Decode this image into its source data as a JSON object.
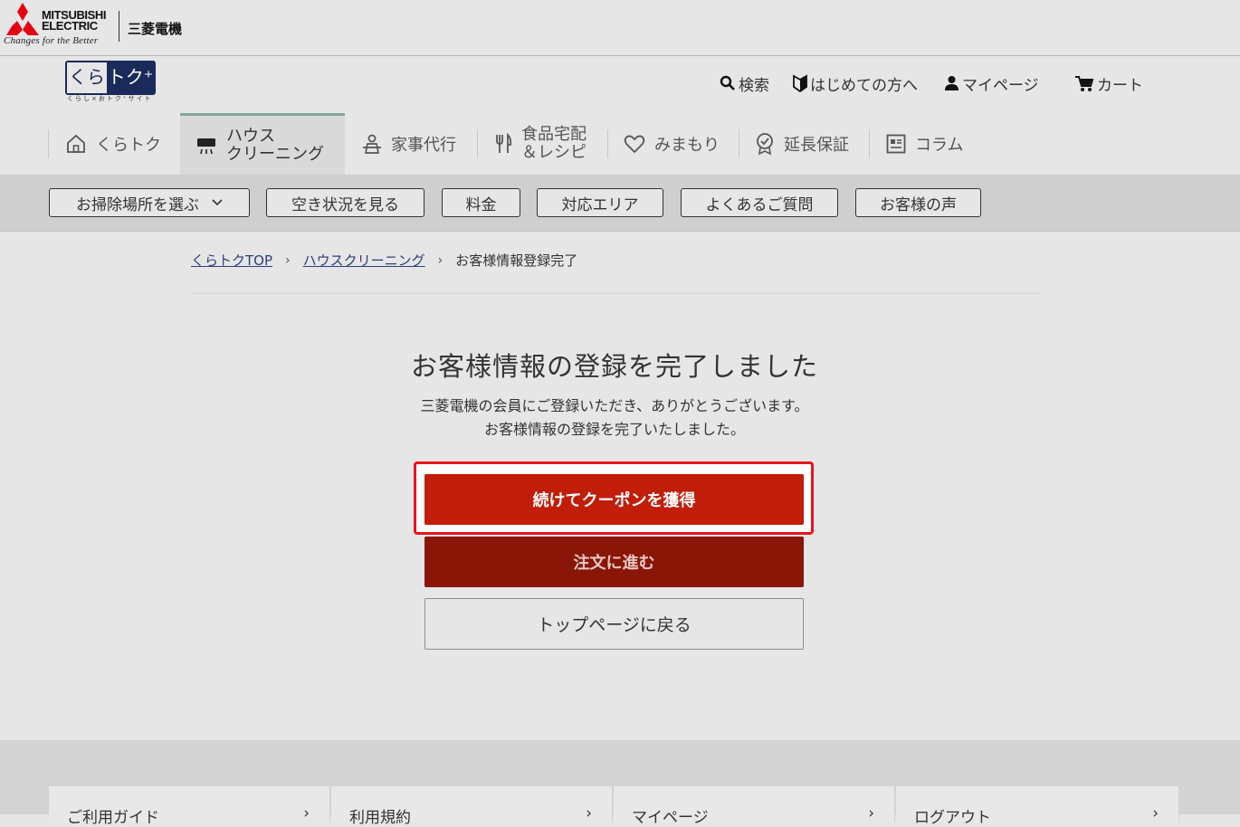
{
  "brand": {
    "company_en_line1": "MITSUBISHI",
    "company_en_line2": "ELECTRIC",
    "tagline": "Changes for the Better",
    "company_jp": "三菱電機",
    "red": "#e60012"
  },
  "site_logo": {
    "left": "くら",
    "right": "トク⁺",
    "sub": "くらし×おトク⁺サイト"
  },
  "utility_nav": {
    "search": "検索",
    "first_time": "はじめての方へ",
    "mypage": "マイページ",
    "cart": "カート"
  },
  "main_nav": {
    "home": "くらトク",
    "cleaning_line1": "ハウス",
    "cleaning_line2": "クリーニング",
    "housework": "家事代行",
    "food_line1": "食品宅配",
    "food_line2": "＆レシピ",
    "watch": "みまもり",
    "warranty": "延長保証",
    "column": "コラム",
    "active_accent": "#7fa79c"
  },
  "sub_nav": {
    "choose_place": "お掃除場所を選ぶ",
    "availability": "空き状況を見る",
    "price": "料金",
    "area": "対応エリア",
    "faq": "よくあるご質問",
    "voice": "お客様の声"
  },
  "breadcrumb": {
    "home": "くらトクTOP",
    "section": "ハウスクリーニング",
    "current": "お客様情報登録完了"
  },
  "content": {
    "title": "お客様情報の登録を完了しました",
    "message_line1": "三菱電機の会員にご登録いただき、ありがとうございます。",
    "message_line2": "お客様情報の登録を完了いたしました。",
    "coupon_button": "続けてクーポンを獲得",
    "order_button": "注文に進む",
    "top_button": "トップページに戻る",
    "primary_color": "#c21d09",
    "focus_color": "#e8141b"
  },
  "footer_links": {
    "guide": "ご利用ガイド",
    "terms": "利用規約",
    "mypage": "マイページ",
    "logout": "ログアウト"
  }
}
